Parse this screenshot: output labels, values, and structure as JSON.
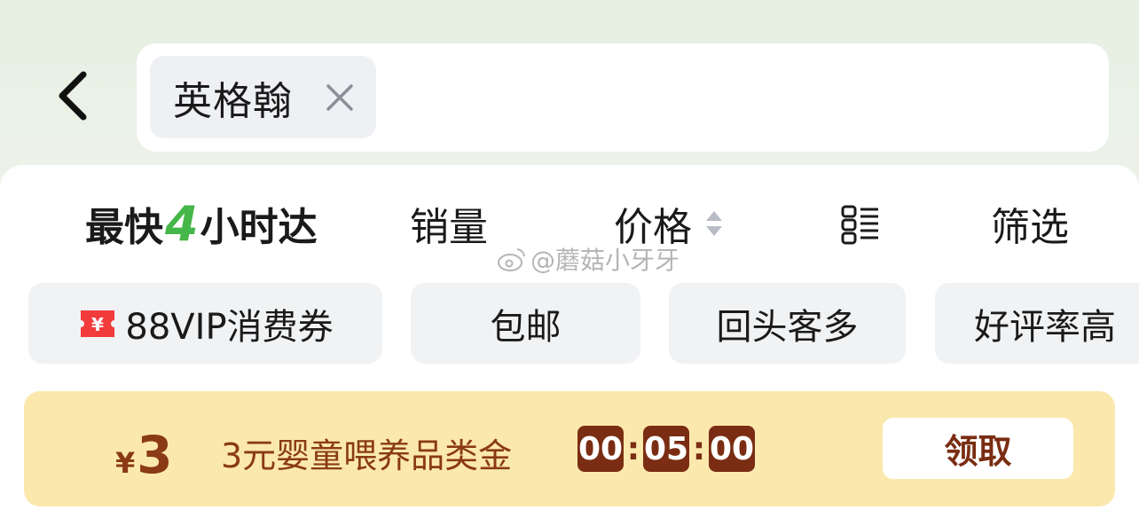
{
  "header": {
    "search_chip": {
      "label": "英格翰"
    }
  },
  "sort_bar": {
    "fast_delivery": {
      "prefix": "最快",
      "number": "4",
      "suffix": "小时达"
    },
    "sales": "销量",
    "price": "价格",
    "filter": "筛选"
  },
  "watermark": "@蘑菇小牙牙",
  "tags": [
    {
      "label": "88VIP消费券",
      "icon": "coupon-icon"
    },
    {
      "label": "包邮"
    },
    {
      "label": "回头客多"
    },
    {
      "label": "好评率高"
    }
  ],
  "promo": {
    "currency": "¥",
    "amount": "3",
    "description": "3元婴童喂养品类金",
    "timer": [
      "00",
      "05",
      "00"
    ],
    "claim_label": "领取"
  },
  "colors": {
    "accent_green": "#45b649",
    "promo_bg": "#fbe8ad",
    "promo_text": "#8a3a14",
    "timer_bg": "#7a2d12",
    "coupon_red": "#f23b3b"
  }
}
